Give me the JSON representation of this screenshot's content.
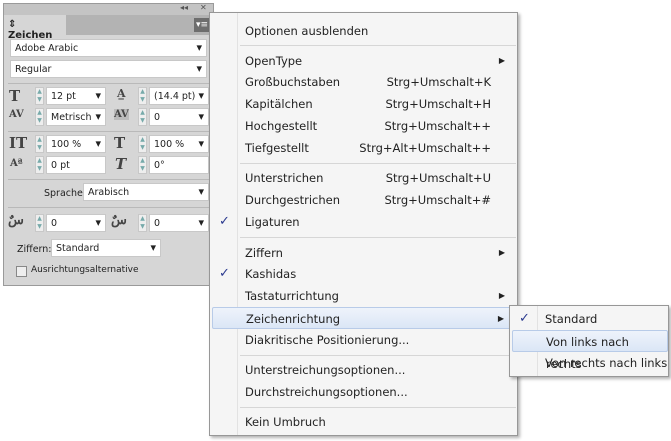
{
  "panel": {
    "title_controls": [
      "◂◂",
      "✕"
    ],
    "tab": "Zeichen",
    "menu_icon": "panel-menu-icon",
    "font_family": "Adobe Arabic",
    "font_style": "Regular",
    "font_size": "12 pt",
    "leading": "(14.4 pt)",
    "kerning": "Metrisch",
    "tracking": "0",
    "vertical_scale": "100 %",
    "horizontal_scale": "100 %",
    "baseline_shift": "0 pt",
    "skew": "0°",
    "language_label": "Sprache:",
    "language": "Arabisch",
    "diacritic_x": "0",
    "diacritic_y": "0",
    "digits_label": "Ziffern:",
    "digits": "Standard",
    "justification_alternate": "Ausrichtungsalternative"
  },
  "menu": {
    "items": [
      {
        "label": "Optionen ausblenden"
      },
      {
        "label": "OpenType",
        "submenu": true
      },
      {
        "label": "Großbuchstaben",
        "shortcut": "Strg+Umschalt+K"
      },
      {
        "label": "Kapitälchen",
        "shortcut": "Strg+Umschalt+H"
      },
      {
        "label": "Hochgestellt",
        "shortcut": "Strg+Umschalt++"
      },
      {
        "label": "Tiefgestellt",
        "shortcut": "Strg+Alt+Umschalt++"
      },
      {
        "label": "Unterstrichen",
        "shortcut": "Strg+Umschalt+U"
      },
      {
        "label": "Durchgestrichen",
        "shortcut": "Strg+Umschalt+#"
      },
      {
        "label": "Ligaturen",
        "checked": true
      },
      {
        "label": "Ziffern",
        "submenu": true
      },
      {
        "label": "Kashidas",
        "checked": true
      },
      {
        "label": "Tastaturrichtung",
        "submenu": true
      },
      {
        "label": "Zeichenrichtung",
        "submenu": true,
        "highlighted": true
      },
      {
        "label": "Diakritische Positionierung..."
      },
      {
        "label": "Unterstreichungsoptionen..."
      },
      {
        "label": "Durchstreichungsoptionen..."
      },
      {
        "label": "Kein Umbruch"
      }
    ],
    "check": "✓",
    "arrow": "▶"
  },
  "submenu": {
    "items": [
      {
        "label": "Standard",
        "checked": true
      },
      {
        "label": "Von links nach rechts",
        "highlighted": true
      },
      {
        "label": "Von rechts nach links"
      }
    ]
  }
}
